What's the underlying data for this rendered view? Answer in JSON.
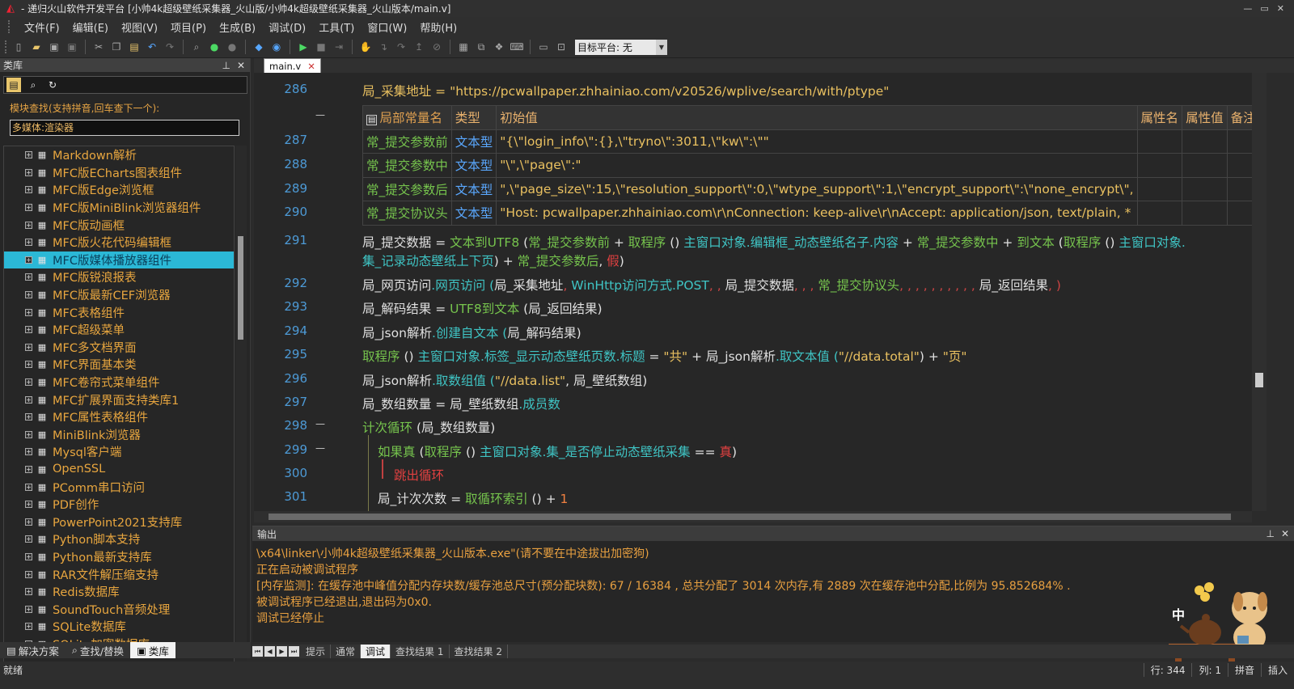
{
  "window": {
    "title": "- 递归火山软件开发平台 [小帅4k超级壁纸采集器_火山版/小帅4k超级壁纸采集器_火山版本/main.v]",
    "controls": [
      "—",
      "▭",
      "✕"
    ]
  },
  "menu": [
    "文件(F)",
    "编辑(E)",
    "视图(V)",
    "项目(P)",
    "生成(B)",
    "调试(D)",
    "工具(T)",
    "窗口(W)",
    "帮助(H)"
  ],
  "toolbar": {
    "icons": [
      "new-file-icon",
      "open-folder-icon",
      "save-icon",
      "save-all-icon",
      "cut-icon",
      "copy-icon",
      "paste-icon",
      "undo-icon",
      "redo-icon",
      "binoculars-icon",
      "go-icon",
      "stop-go-icon",
      "settings-icon",
      "globe-icon",
      "run-icon",
      "stop-icon",
      "step-icon",
      "hand-icon",
      "step-into-icon",
      "step-over-icon",
      "step-out-icon",
      "window-icon",
      "watch-icon",
      "memory-icon",
      "breakpoint-icon",
      "window2-icon",
      "search-window-icon"
    ],
    "platform_value": "目标平台: 无"
  },
  "library": {
    "title": "类库",
    "hint": "模块查找(支持拼音,回车查下一个):",
    "search_value": "多媒体:渲染器",
    "items": [
      "Markdown解析",
      "MFC版ECharts图表组件",
      "MFC版Edge浏览框",
      "MFC版MiniBlink浏览器组件",
      "MFC版动画框",
      "MFC版火花代码编辑框",
      "MFC版媒体播放器组件",
      "MFC版锐浪报表",
      "MFC版最新CEF浏览器",
      "MFC表格组件",
      "MFC超级菜单",
      "MFC多文档界面",
      "MFC界面基本类",
      "MFC卷帘式菜单组件",
      "MFC扩展界面支持类库1",
      "MFC属性表格组件",
      "MiniBlink浏览器",
      "Mysql客户端",
      "OpenSSL",
      "PComm串口访问",
      "PDF创作",
      "PowerPoint2021支持库",
      "Python脚本支持",
      "Python最新支持库",
      "RAR文件解压缩支持",
      "Redis数据库",
      "SoundTouch音频处理",
      "SQLite数据库",
      "SQLite加密数据库"
    ],
    "selected_index": 6,
    "bottom_tabs": [
      "解决方案",
      "查找/替换",
      "类库"
    ]
  },
  "editor": {
    "tab": "main.v",
    "table_header": [
      "局部常量名",
      "类型",
      "初始值",
      "属性名",
      "属性值",
      "备注"
    ],
    "table_rows": [
      {
        "ln": "287",
        "name": "常_提交参数前",
        "type": "文本型",
        "value": "\"{\\\"login_info\\\":{},\\\"tryno\\\":3011,\\\"kw\\\":\\\"\""
      },
      {
        "ln": "288",
        "name": "常_提交参数中",
        "type": "文本型",
        "value": "\"\\\",\\\"page\\\":\""
      },
      {
        "ln": "289",
        "name": "常_提交参数后",
        "type": "文本型",
        "value": "\",\\\"page_size\\\":15,\\\"resolution_support\\\":0,\\\"wtype_support\\\":1,\\\"encrypt_support\\\":\\\"none_encrypt\\\","
      },
      {
        "ln": "290",
        "name": "常_提交协议头",
        "type": "文本型",
        "value": "\"Host: pcwallpaper.zhhainiao.com\\r\\nConnection: keep-alive\\r\\nAccept: application/json, text/plain, *"
      }
    ],
    "line_numbers": [
      "286",
      "291",
      "292",
      "293",
      "294",
      "295",
      "296",
      "297",
      "298",
      "299",
      "300",
      "301"
    ],
    "lines": {
      "l286": "局_采集地址 = \"https://pcwallpaper.zhhainiao.com/v20526/wplive/search/with/ptype\"",
      "l291a_1": "局_提交数据",
      "l291a_2": " = ",
      "l291a_3": "文本到UTF8",
      "l291a_4": " (",
      "l291a_5": "常_提交参数前",
      "l291a_6": " + ",
      "l291a_7": "取程序",
      "l291a_8": " () ",
      "l291a_9": "主窗口对象",
      "l291a_10": ".编辑框_动态壁纸名子.内容",
      "l291a_11": " + ",
      "l291a_12": "常_提交参数中",
      "l291a_13": " + ",
      "l291a_14": "到文本",
      "l291a_15": " (",
      "l291a_16": "取程序",
      "l291a_17": " () ",
      "l291a_18": "主窗口对象.",
      "l291b_1": "集_记录动态壁纸上下页",
      "l291b_2": ") + ",
      "l291b_3": "常_提交参数后",
      "l291b_4": ", ",
      "l291b_5": "假",
      "l291b_6": ")",
      "l292_1": "局_网页访问",
      "l292_2": ".网页访问 (",
      "l292_3": "局_采集地址",
      "l292_4": ", ",
      "l292_5": "WinHttp访问方式.POST",
      "l292_6": ", , ",
      "l292_7": "局_提交数据",
      "l292_8": ", , , ",
      "l292_9": "常_提交协议头",
      "l292_10": ", , , , , , , , , , ",
      "l292_11": "局_返回结果",
      "l292_12": ", )",
      "l293_1": "局_解码结果",
      "l293_2": " = ",
      "l293_3": "UTF8到文本",
      "l293_4": " (",
      "l293_5": "局_返回结果",
      "l293_6": ")",
      "l294_1": "局_json解析",
      "l294_2": ".创建自文本 (",
      "l294_3": "局_解码结果",
      "l294_4": ")",
      "l295_1": "取程序",
      "l295_2": " () ",
      "l295_3": "主窗口对象.标签_显示动态壁纸页数.标题",
      "l295_4": " = ",
      "l295_5": "\"共\"",
      "l295_6": " + ",
      "l295_7": "局_json解析",
      "l295_8": ".取文本值 (",
      "l295_9": "\"//data.total\"",
      "l295_10": ") + ",
      "l295_11": "\"页\"",
      "l296_1": "局_json解析",
      "l296_2": ".取数组值 (",
      "l296_3": "\"//data.list\"",
      "l296_4": ", ",
      "l296_5": "局_壁纸数组",
      "l296_6": ")",
      "l297_1": "局_数组数量",
      "l297_2": " = ",
      "l297_3": "局_壁纸数组",
      "l297_4": ".成员数",
      "l298_1": "计次循环",
      "l298_2": " (",
      "l298_3": "局_数组数量",
      "l298_4": ")",
      "l299_1": "如果真",
      "l299_2": " (",
      "l299_3": "取程序",
      "l299_4": " () ",
      "l299_5": "主窗口对象.集_是否停止动态壁纸采集",
      "l299_6": " == ",
      "l299_7": "真",
      "l299_8": ")",
      "l300_1": "跳出循环",
      "l301_1": "局_计次次数",
      "l301_2": " = ",
      "l301_3": "取循环索引",
      "l301_4": " () + ",
      "l301_5": "1"
    }
  },
  "output": {
    "title": "输出",
    "lines": [
      "\\x64\\linker\\小帅4k超级壁纸采集器_火山版本.exe\"(请不要在中途拔出加密狗)",
      "正在启动被调试程序",
      "[内存监测]: 在缓存池中峰值分配内存块数/缓存池总尺寸(预分配块数): 67 / 16384 , 总共分配了 3014 次内存,有 2889 次在缓存池中分配,比例为 95.852684% .",
      "被调试程序已经退出,退出码为0x0.",
      "调试已经停止"
    ],
    "ime_label": "中",
    "tabs": [
      "提示",
      "通常",
      "调试",
      "查找结果 1",
      "查找结果 2"
    ],
    "active_tab": "调试"
  },
  "status": {
    "ready": "就绪",
    "row": "行: 344",
    "col": "列: 1",
    "ime": "拼音",
    "mode": "插入"
  }
}
